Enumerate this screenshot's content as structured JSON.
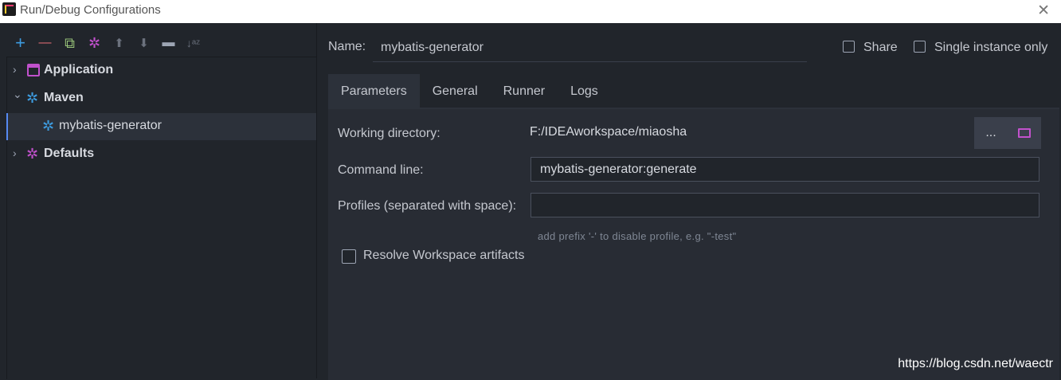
{
  "window": {
    "title": "Run/Debug Configurations",
    "close_glyph": "✕"
  },
  "toolbar": {
    "icons": [
      "add-icon",
      "remove-icon",
      "copy-icon",
      "settings-icon",
      "move-up-icon",
      "move-down-icon",
      "folder-icon",
      "sort-icon"
    ],
    "add_glyph": "+",
    "remove_glyph": "—",
    "copy_glyph": "⧉",
    "settings_glyph": "✲",
    "up_glyph": "⬆",
    "down_glyph": "⬇",
    "folder_glyph": "▬",
    "sort_glyph": "↓ᵃᶻ"
  },
  "tree": {
    "items": [
      {
        "label": "Application",
        "expanded": false
      },
      {
        "label": "Maven",
        "expanded": true
      },
      {
        "label": "mybatis-generator",
        "selected": true
      },
      {
        "label": "Defaults",
        "expanded": false
      }
    ],
    "collapsed_glyph": "›",
    "expanded_glyph": "⌄",
    "gear_glyph": "✲"
  },
  "config": {
    "name_label": "Name:",
    "name_value": "mybatis-generator",
    "share_label": "Share",
    "single_instance_label": "Single instance only"
  },
  "tabs": [
    "Parameters",
    "General",
    "Runner",
    "Logs"
  ],
  "parameters": {
    "working_dir_label": "Working directory:",
    "working_dir_value": "F:/IDEAworkspace/miaosha",
    "browse_dots": "...",
    "command_line_label": "Command line:",
    "command_line_value": "mybatis-generator:generate",
    "profiles_label": "Profiles (separated with space):",
    "profiles_value": "",
    "profiles_hint": "add prefix '-' to disable profile, e.g. \"-test\"",
    "resolve_label": "Resolve Workspace artifacts"
  },
  "watermark": "https://blog.csdn.net/waectr",
  "colors": {
    "accent_purple": "#c151cc",
    "accent_blue": "#3d9ce0",
    "accent_green": "#98c379",
    "accent_red": "#e06c75",
    "selection_bar": "#568af2"
  }
}
